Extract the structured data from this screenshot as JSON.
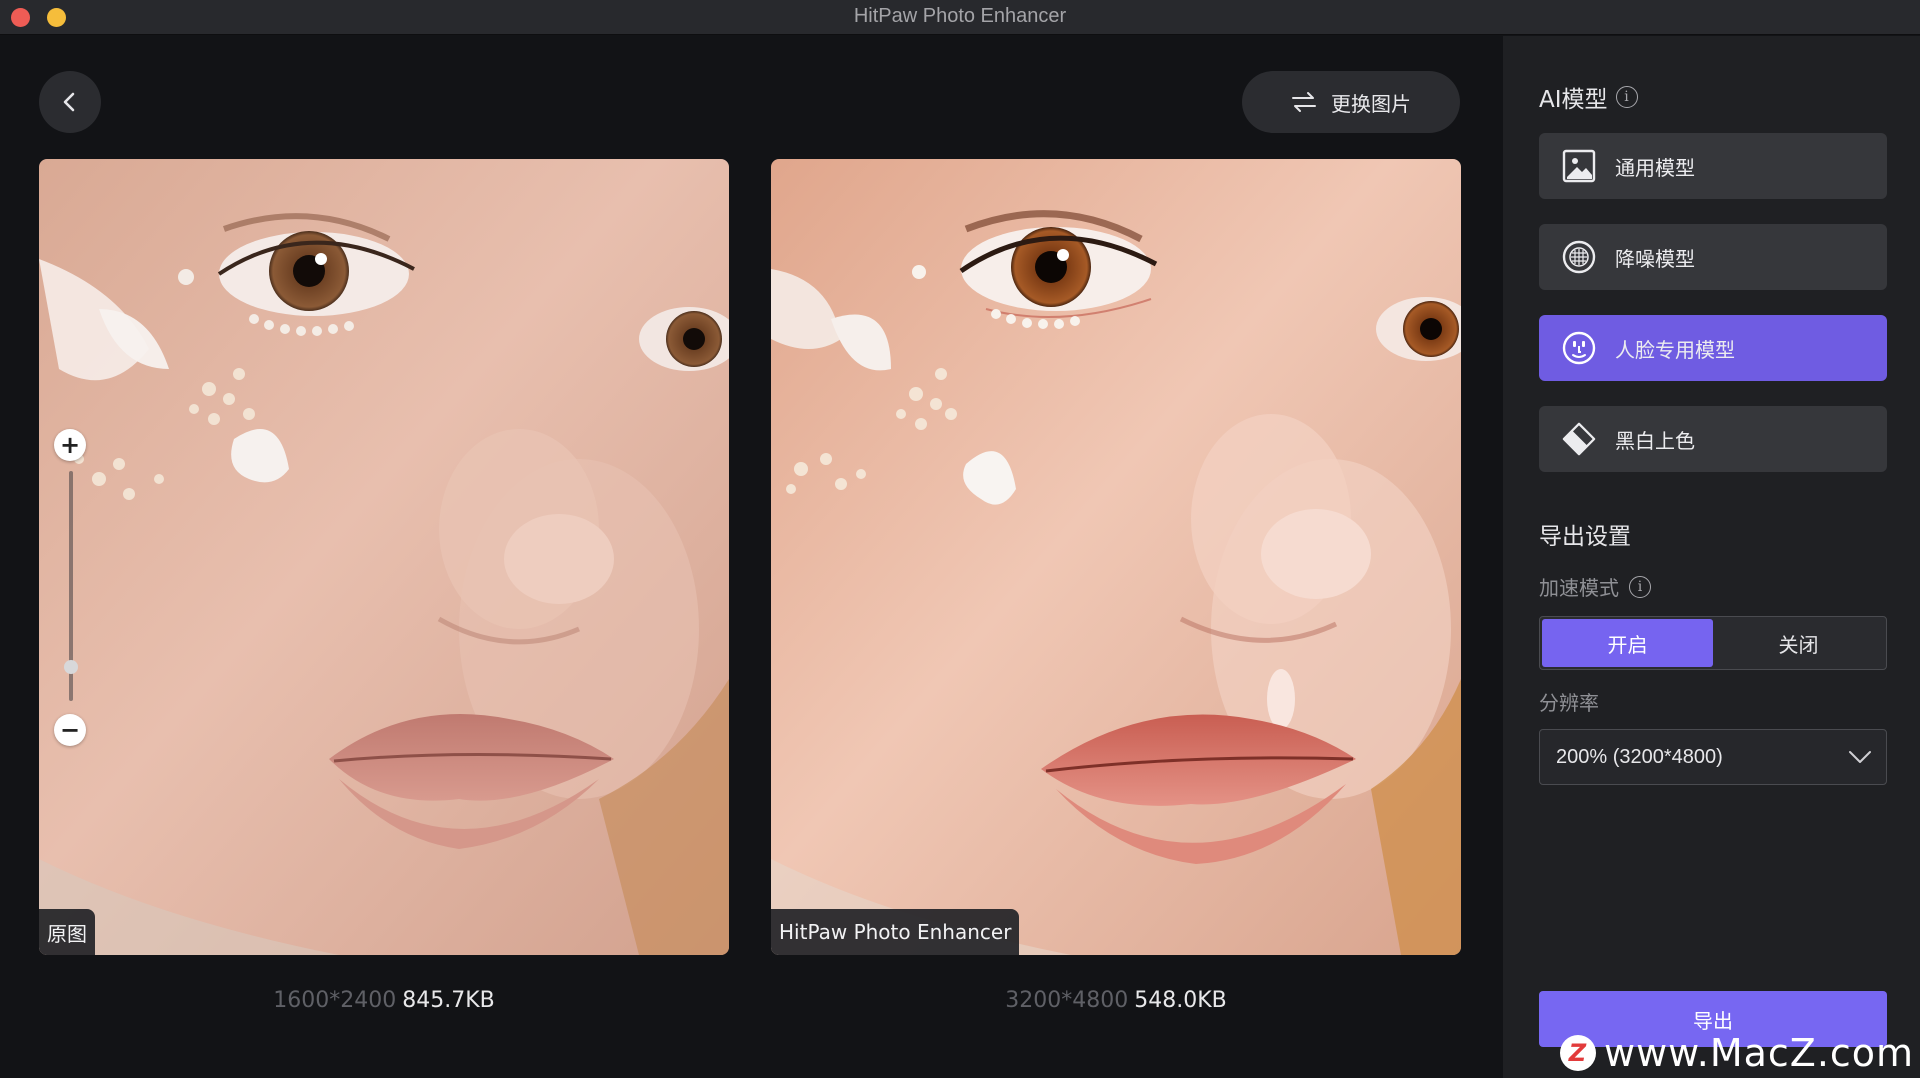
{
  "window": {
    "title": "HitPaw Photo Enhancer"
  },
  "toolbar": {
    "replace_label": "更换图片"
  },
  "original": {
    "tag": "原图",
    "resolution": "1600*2400",
    "size": "845.7KB"
  },
  "enhanced": {
    "tag": "HitPaw Photo Enhancer",
    "resolution": "3200*4800",
    "size": "548.0KB"
  },
  "zoom": {
    "plus": "+",
    "minus": "−",
    "level": 0.15
  },
  "panel": {
    "ai_model_title": "AI模型",
    "models": [
      {
        "label": "通用模型",
        "icon": "image-icon",
        "active": false
      },
      {
        "label": "降噪模型",
        "icon": "denoise-icon",
        "active": false
      },
      {
        "label": "人脸专用模型",
        "icon": "face-icon",
        "active": true
      },
      {
        "label": "黑白上色",
        "icon": "colorize-icon",
        "active": false
      }
    ],
    "export_settings_title": "导出设置",
    "accel_label": "加速模式",
    "accel_on": "开启",
    "accel_off": "关闭",
    "accel_selected": "开启",
    "resolution_label": "分辨率",
    "resolution_value": "200% (3200*4800)",
    "export_label": "导出"
  },
  "watermark": {
    "logo": "Z",
    "text": "www.MacZ.com"
  },
  "colors": {
    "accent": "#7664f0",
    "panel": "#1f2023",
    "background": "#121316"
  }
}
